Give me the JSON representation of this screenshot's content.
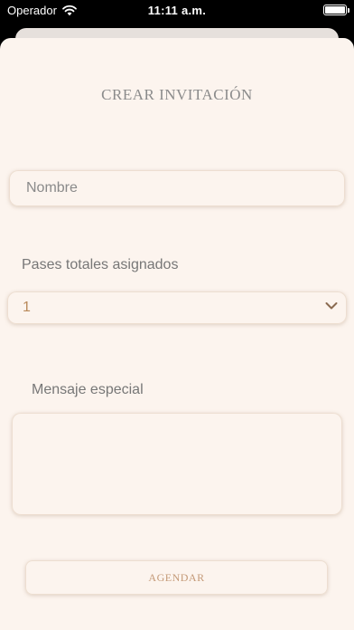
{
  "status_bar": {
    "carrier": "Operador",
    "time": "11:11 a.m."
  },
  "sheet": {
    "title": "CREAR INVITACIÓN"
  },
  "form": {
    "name_placeholder": "Nombre",
    "passes_label": "Pases totales asignados",
    "passes_value": "1",
    "message_label": "Mensaje especial",
    "message_value": "",
    "submit_label": "AGENDAR"
  },
  "colors": {
    "sheet_background": "#fcf4ee",
    "accent": "#b98a5a",
    "button_text": "#c49a78"
  },
  "icons": {
    "wifi": "wifi-icon",
    "battery": "battery-icon",
    "dropdown": "chevron-down-icon"
  }
}
